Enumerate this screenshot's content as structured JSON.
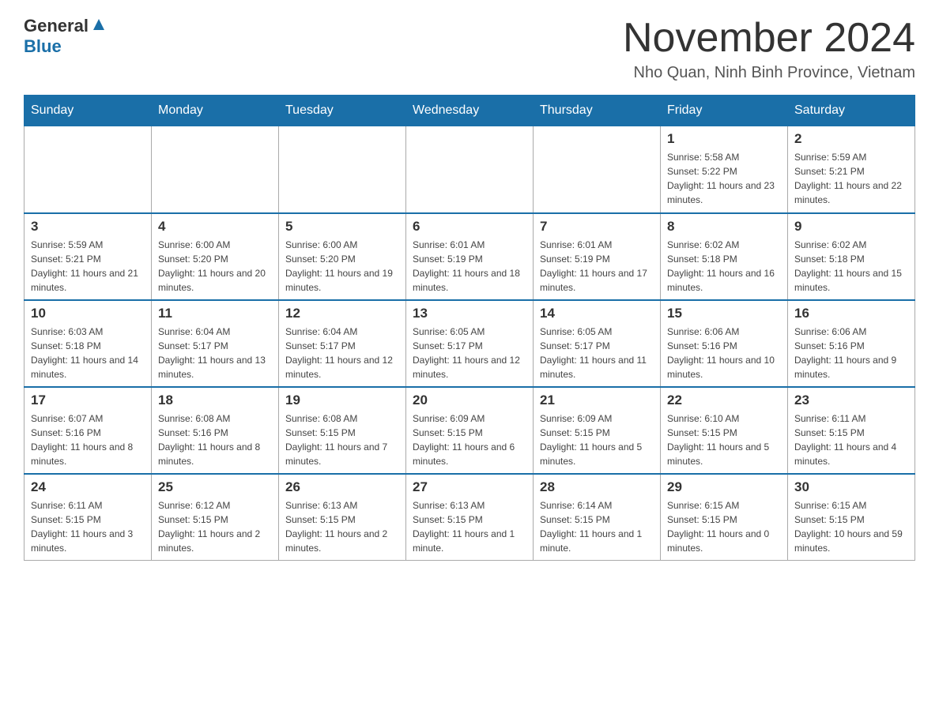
{
  "header": {
    "logo_general": "General",
    "logo_blue": "Blue",
    "month_title": "November 2024",
    "location": "Nho Quan, Ninh Binh Province, Vietnam"
  },
  "weekdays": [
    "Sunday",
    "Monday",
    "Tuesday",
    "Wednesday",
    "Thursday",
    "Friday",
    "Saturday"
  ],
  "weeks": [
    [
      {
        "day": "",
        "info": ""
      },
      {
        "day": "",
        "info": ""
      },
      {
        "day": "",
        "info": ""
      },
      {
        "day": "",
        "info": ""
      },
      {
        "day": "",
        "info": ""
      },
      {
        "day": "1",
        "info": "Sunrise: 5:58 AM\nSunset: 5:22 PM\nDaylight: 11 hours and 23 minutes."
      },
      {
        "day": "2",
        "info": "Sunrise: 5:59 AM\nSunset: 5:21 PM\nDaylight: 11 hours and 22 minutes."
      }
    ],
    [
      {
        "day": "3",
        "info": "Sunrise: 5:59 AM\nSunset: 5:21 PM\nDaylight: 11 hours and 21 minutes."
      },
      {
        "day": "4",
        "info": "Sunrise: 6:00 AM\nSunset: 5:20 PM\nDaylight: 11 hours and 20 minutes."
      },
      {
        "day": "5",
        "info": "Sunrise: 6:00 AM\nSunset: 5:20 PM\nDaylight: 11 hours and 19 minutes."
      },
      {
        "day": "6",
        "info": "Sunrise: 6:01 AM\nSunset: 5:19 PM\nDaylight: 11 hours and 18 minutes."
      },
      {
        "day": "7",
        "info": "Sunrise: 6:01 AM\nSunset: 5:19 PM\nDaylight: 11 hours and 17 minutes."
      },
      {
        "day": "8",
        "info": "Sunrise: 6:02 AM\nSunset: 5:18 PM\nDaylight: 11 hours and 16 minutes."
      },
      {
        "day": "9",
        "info": "Sunrise: 6:02 AM\nSunset: 5:18 PM\nDaylight: 11 hours and 15 minutes."
      }
    ],
    [
      {
        "day": "10",
        "info": "Sunrise: 6:03 AM\nSunset: 5:18 PM\nDaylight: 11 hours and 14 minutes."
      },
      {
        "day": "11",
        "info": "Sunrise: 6:04 AM\nSunset: 5:17 PM\nDaylight: 11 hours and 13 minutes."
      },
      {
        "day": "12",
        "info": "Sunrise: 6:04 AM\nSunset: 5:17 PM\nDaylight: 11 hours and 12 minutes."
      },
      {
        "day": "13",
        "info": "Sunrise: 6:05 AM\nSunset: 5:17 PM\nDaylight: 11 hours and 12 minutes."
      },
      {
        "day": "14",
        "info": "Sunrise: 6:05 AM\nSunset: 5:17 PM\nDaylight: 11 hours and 11 minutes."
      },
      {
        "day": "15",
        "info": "Sunrise: 6:06 AM\nSunset: 5:16 PM\nDaylight: 11 hours and 10 minutes."
      },
      {
        "day": "16",
        "info": "Sunrise: 6:06 AM\nSunset: 5:16 PM\nDaylight: 11 hours and 9 minutes."
      }
    ],
    [
      {
        "day": "17",
        "info": "Sunrise: 6:07 AM\nSunset: 5:16 PM\nDaylight: 11 hours and 8 minutes."
      },
      {
        "day": "18",
        "info": "Sunrise: 6:08 AM\nSunset: 5:16 PM\nDaylight: 11 hours and 8 minutes."
      },
      {
        "day": "19",
        "info": "Sunrise: 6:08 AM\nSunset: 5:15 PM\nDaylight: 11 hours and 7 minutes."
      },
      {
        "day": "20",
        "info": "Sunrise: 6:09 AM\nSunset: 5:15 PM\nDaylight: 11 hours and 6 minutes."
      },
      {
        "day": "21",
        "info": "Sunrise: 6:09 AM\nSunset: 5:15 PM\nDaylight: 11 hours and 5 minutes."
      },
      {
        "day": "22",
        "info": "Sunrise: 6:10 AM\nSunset: 5:15 PM\nDaylight: 11 hours and 5 minutes."
      },
      {
        "day": "23",
        "info": "Sunrise: 6:11 AM\nSunset: 5:15 PM\nDaylight: 11 hours and 4 minutes."
      }
    ],
    [
      {
        "day": "24",
        "info": "Sunrise: 6:11 AM\nSunset: 5:15 PM\nDaylight: 11 hours and 3 minutes."
      },
      {
        "day": "25",
        "info": "Sunrise: 6:12 AM\nSunset: 5:15 PM\nDaylight: 11 hours and 2 minutes."
      },
      {
        "day": "26",
        "info": "Sunrise: 6:13 AM\nSunset: 5:15 PM\nDaylight: 11 hours and 2 minutes."
      },
      {
        "day": "27",
        "info": "Sunrise: 6:13 AM\nSunset: 5:15 PM\nDaylight: 11 hours and 1 minute."
      },
      {
        "day": "28",
        "info": "Sunrise: 6:14 AM\nSunset: 5:15 PM\nDaylight: 11 hours and 1 minute."
      },
      {
        "day": "29",
        "info": "Sunrise: 6:15 AM\nSunset: 5:15 PM\nDaylight: 11 hours and 0 minutes."
      },
      {
        "day": "30",
        "info": "Sunrise: 6:15 AM\nSunset: 5:15 PM\nDaylight: 10 hours and 59 minutes."
      }
    ]
  ]
}
